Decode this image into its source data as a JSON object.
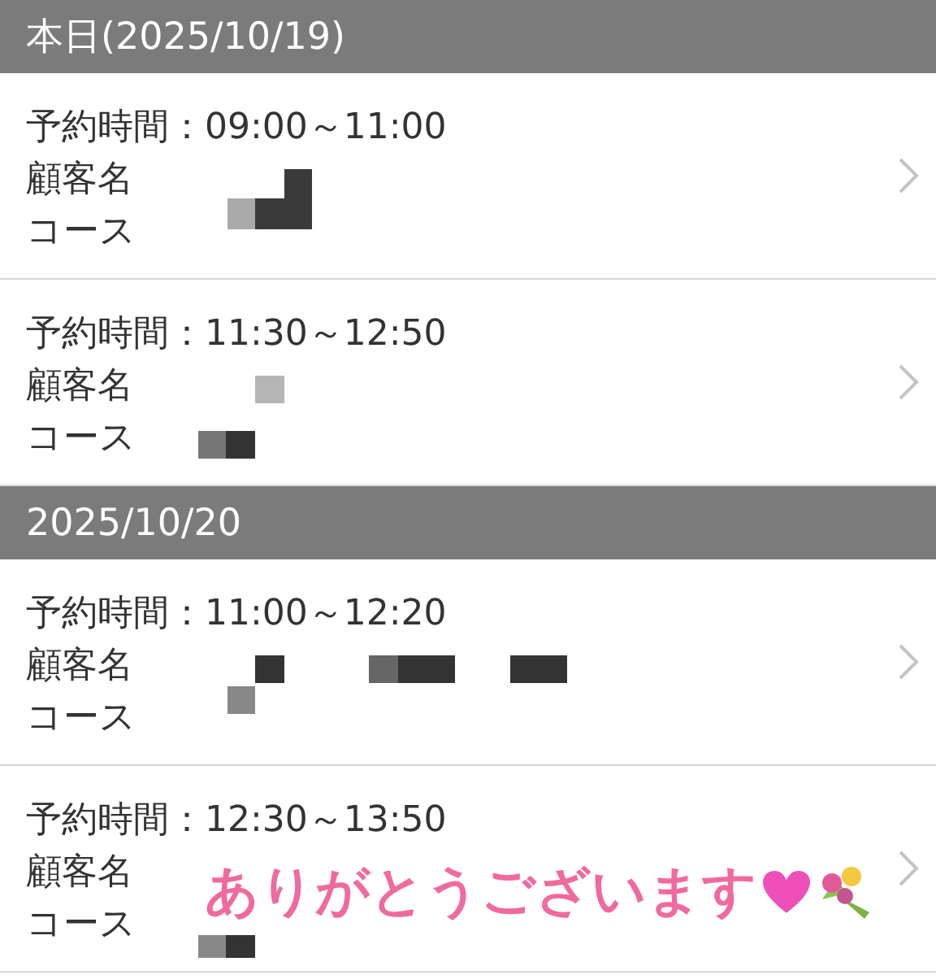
{
  "sections": [
    {
      "heading": "本日(2025/10/19)",
      "appointments": [
        {
          "time": "予約時間：09:00～11:00",
          "name_label": "顧客名",
          "course_label": "コース"
        },
        {
          "time": "予約時間：11:30～12:50",
          "name_label": "顧客名",
          "course_label": "コース"
        }
      ]
    },
    {
      "heading": "2025/10/20",
      "appointments": [
        {
          "time": "予約時間：11:00～12:20",
          "name_label": "顧客名",
          "course_label": "コース"
        },
        {
          "time": "予約時間：12:30～13:50",
          "name_label": "顧客名",
          "course_label": "コース"
        }
      ]
    }
  ],
  "sticker": {
    "text": "ありがとうございます"
  }
}
